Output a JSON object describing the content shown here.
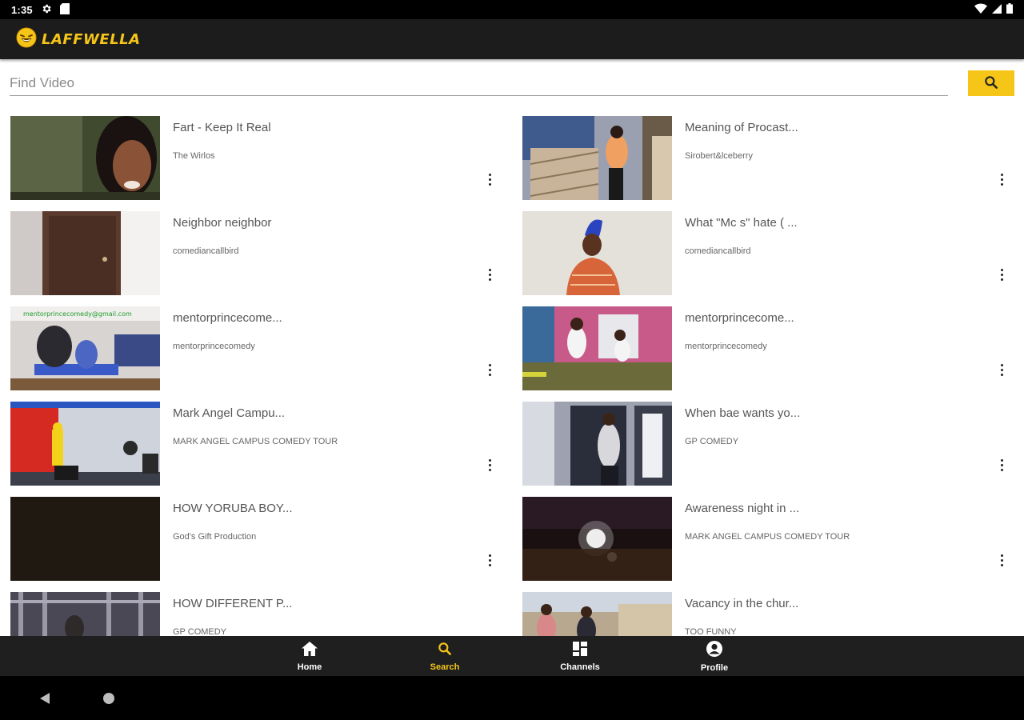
{
  "status_bar": {
    "time": "1:35"
  },
  "app": {
    "name": "LAFFWELLA",
    "accent": "#f5c518"
  },
  "search": {
    "placeholder": "Find Video",
    "value": "",
    "button_icon": "search-icon"
  },
  "videos": {
    "left": [
      {
        "title": "Fart - Keep It Real",
        "channel": "The Wirlos"
      },
      {
        "title": "Neighbor neighbor",
        "channel": "comediancallbird"
      },
      {
        "title": "mentorprincecome...",
        "channel": "mentorprincecomedy"
      },
      {
        "title": "Mark Angel Campu...",
        "channel": "MARK ANGEL CAMPUS COMEDY TOUR"
      },
      {
        "title": "HOW YORUBA BOY...",
        "channel": "God's Gift Production"
      },
      {
        "title": "HOW DIFFERENT P...",
        "channel": "GP COMEDY"
      }
    ],
    "right": [
      {
        "title": "Meaning of Procast...",
        "channel": "Sirobert&lceberry"
      },
      {
        "title": "What \"Mc s\" hate ( ...",
        "channel": "comediancallbird"
      },
      {
        "title": "mentorprincecome...",
        "channel": "mentorprincecomedy"
      },
      {
        "title": "When bae wants yo...",
        "channel": "GP COMEDY"
      },
      {
        "title": "Awareness night in ...",
        "channel": "MARK ANGEL CAMPUS COMEDY TOUR"
      },
      {
        "title": "Vacancy in the chur...",
        "channel": "TOO FUNNY"
      }
    ]
  },
  "thumb_overlay": {
    "email_text": "mentorprincecomedy@gmail.com"
  },
  "bottom_nav": [
    {
      "label": "Home",
      "icon": "home-icon",
      "active": false
    },
    {
      "label": "Search",
      "icon": "search-icon",
      "active": true
    },
    {
      "label": "Channels",
      "icon": "channels-icon",
      "active": false
    },
    {
      "label": "Profile",
      "icon": "profile-icon",
      "active": false
    }
  ]
}
